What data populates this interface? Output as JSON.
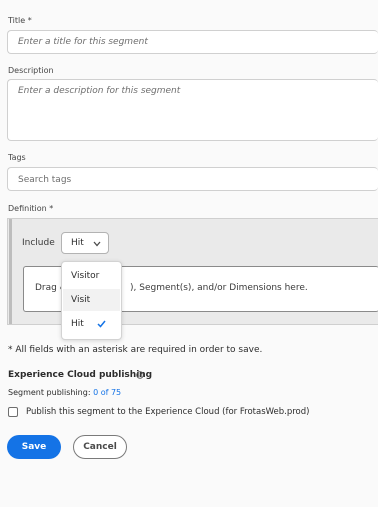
{
  "title_field": {
    "label": "Title",
    "required": "*",
    "placeholder": "Enter a title for this segment"
  },
  "description_field": {
    "label": "Description",
    "placeholder": "Enter a description for this segment"
  },
  "tags_field": {
    "label": "Tags",
    "placeholder": "Search tags"
  },
  "definition": {
    "label": "Definition",
    "required": "*",
    "include_label": "Include",
    "scope_selected": "Hit",
    "dropzone_prefix": "Drag &",
    "dropzone_suffix": "), Segment(s), and/or Dimensions here.",
    "menu_options": [
      "Visitor",
      "Visit",
      "Hit"
    ]
  },
  "required_note": "* All fields with an asterisk are required in order to save.",
  "ec_publishing": {
    "heading": "Experience Cloud publishing",
    "count_label": "Segment publishing:",
    "count_value": "0 of 75",
    "checkbox_label": "Publish this segment to the Experience Cloud (for FrotasWeb.prod)"
  },
  "buttons": {
    "save": "Save",
    "cancel": "Cancel"
  },
  "colors": {
    "accent": "#1473e6",
    "background": "#fafafa",
    "link": "#1473e6"
  }
}
